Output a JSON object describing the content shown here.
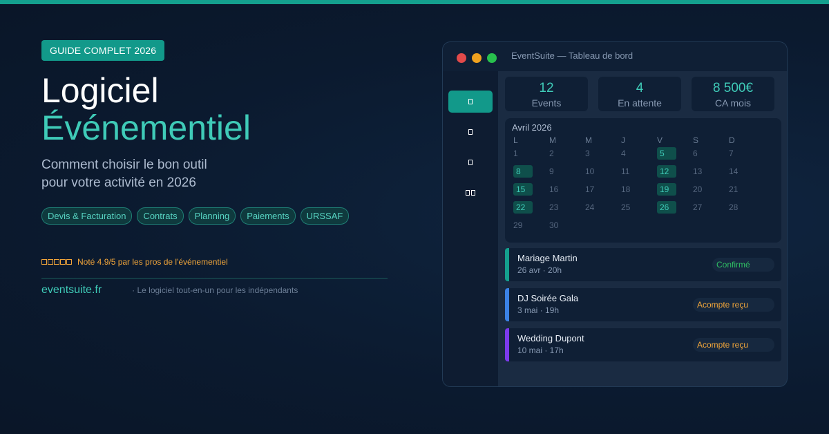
{
  "hero": {
    "badge": "GUIDE COMPLET 2026",
    "title_line1": "Logiciel",
    "title_line2": "Événementiel",
    "subtitle_line1": "Comment choisir le bon outil",
    "subtitle_line2": "pour votre activité en 2026",
    "tags": [
      "Devis & Facturation",
      "Contrats",
      "Planning",
      "Paiements",
      "URSSAF"
    ],
    "rating_text": "Noté 4.9/5 par les pros de l'événementiel",
    "rating_stars": 5,
    "site": "eventsuite.fr",
    "tagline": "· Le logiciel tout-en-un pour les indépendants"
  },
  "colors": {
    "accent": "#3fcbb8",
    "badge": "#12998a",
    "background": "#0c1a30",
    "star": "#f2a63a",
    "confirmed": "#2fbf63",
    "deposit": "#f2a63a"
  },
  "window": {
    "title": "EventSuite — Tableau de bord",
    "sidebar_icons": [
      "dashboard-icon",
      "calendar-icon",
      "document-icon",
      "users-icon"
    ],
    "stats": [
      {
        "value": "12",
        "label": "Events"
      },
      {
        "value": "4",
        "label": "En attente"
      },
      {
        "value": "8 500€",
        "label": "CA mois"
      }
    ],
    "calendar": {
      "month": "Avril 2026",
      "weekdays": [
        "L",
        "M",
        "M",
        "J",
        "V",
        "S",
        "D"
      ],
      "rows": [
        [
          "1",
          "2",
          "3",
          "4",
          "5",
          "6",
          "7"
        ],
        [
          "8",
          "9",
          "10",
          "11",
          "12",
          "13",
          "14"
        ],
        [
          "15",
          "16",
          "17",
          "18",
          "19",
          "20",
          "21"
        ],
        [
          "22",
          "23",
          "24",
          "25",
          "26",
          "27",
          "28"
        ],
        [
          "29",
          "30"
        ]
      ],
      "highlighted": [
        "5",
        "8",
        "12",
        "15",
        "19",
        "22",
        "26"
      ]
    },
    "events": [
      {
        "name": "Mariage Martin",
        "time": "26 avr · 20h",
        "status": "Confirmé",
        "bar_color": "#14a08e",
        "status_color": "#2fbf63"
      },
      {
        "name": "DJ Soirée Gala",
        "time": "3 mai · 19h",
        "status": "Acompte reçu",
        "bar_color": "#3b82e6",
        "status_color": "#f2a63a"
      },
      {
        "name": "Wedding Dupont",
        "time": "10 mai · 17h",
        "status": "Acompte reçu",
        "bar_color": "#7c3aed",
        "status_color": "#f2a63a"
      }
    ]
  }
}
